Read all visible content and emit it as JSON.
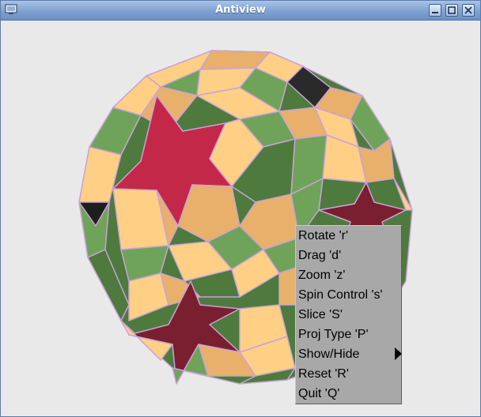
{
  "window": {
    "title": "Antiview"
  },
  "titlebar_buttons": {
    "minimize_icon": "minimize-icon",
    "maximize_icon": "maximize-icon",
    "close_icon": "close-icon"
  },
  "viewport": {
    "subject": "snub polyhedron with star faces",
    "colors": {
      "red_star": "#c42848",
      "green": "#6fa35a",
      "tan": "#ffcf86",
      "dark_green": "#4e7a3e",
      "edge": "#c9a3d6",
      "background": "#e9e9e9"
    }
  },
  "context_menu": {
    "items": [
      {
        "label": "Rotate  'r'"
      },
      {
        "label": "Drag  'd'"
      },
      {
        "label": "Zoom  'z'"
      },
      {
        "label": "Spin Control 's'"
      },
      {
        "label": "Slice  'S'"
      },
      {
        "label": "Proj Type  'P'"
      },
      {
        "label": "Show/Hide",
        "submenu": true
      },
      {
        "label": "Reset  'R'"
      },
      {
        "label": "Quit  'Q'"
      }
    ]
  }
}
